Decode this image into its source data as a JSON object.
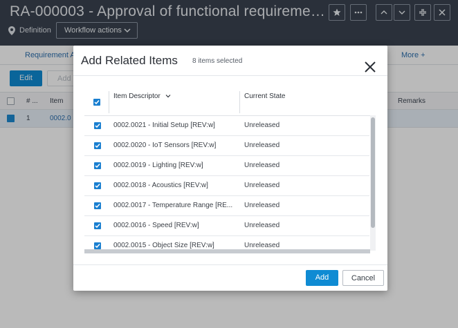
{
  "header": {
    "title": "RA-000003 - Approval of functional requireme…",
    "definition_label": "Definition",
    "workflow_button": "Workflow actions"
  },
  "subnav": {
    "tab_label": "Requirement A",
    "more_label": "More +"
  },
  "toolbar": {
    "edit_label": "Edit",
    "add_label": "Add"
  },
  "background_table": {
    "columns": [
      "# ...",
      "Item",
      "Remarks"
    ],
    "row": {
      "number": "1",
      "item": "0002.0"
    }
  },
  "modal": {
    "title": "Add Related Items",
    "selected_text": "8 items selected",
    "columns": {
      "descriptor": "Item Descriptor",
      "state": "Current State"
    },
    "rows": [
      {
        "descriptor": "0002.0021 - Initial Setup [REV:w]",
        "state": "Unreleased"
      },
      {
        "descriptor": "0002.0020 - IoT Sensors [REV:w]",
        "state": "Unreleased"
      },
      {
        "descriptor": "0002.0019 - Lighting [REV:w]",
        "state": "Unreleased"
      },
      {
        "descriptor": "0002.0018 - Acoustics [REV:w]",
        "state": "Unreleased"
      },
      {
        "descriptor": "0002.0017 - Temperature Range [RE...",
        "state": "Unreleased"
      },
      {
        "descriptor": "0002.0016 - Speed [REV:w]",
        "state": "Unreleased"
      },
      {
        "descriptor": "0002.0015 - Object Size [REV:w]",
        "state": "Unreleased"
      }
    ],
    "add_button": "Add",
    "cancel_button": "Cancel"
  },
  "colors": {
    "header_bg": "#3a4350",
    "primary": "#0f8bd3",
    "checkbox": "#1a7fd0",
    "link": "#2c6fae"
  }
}
